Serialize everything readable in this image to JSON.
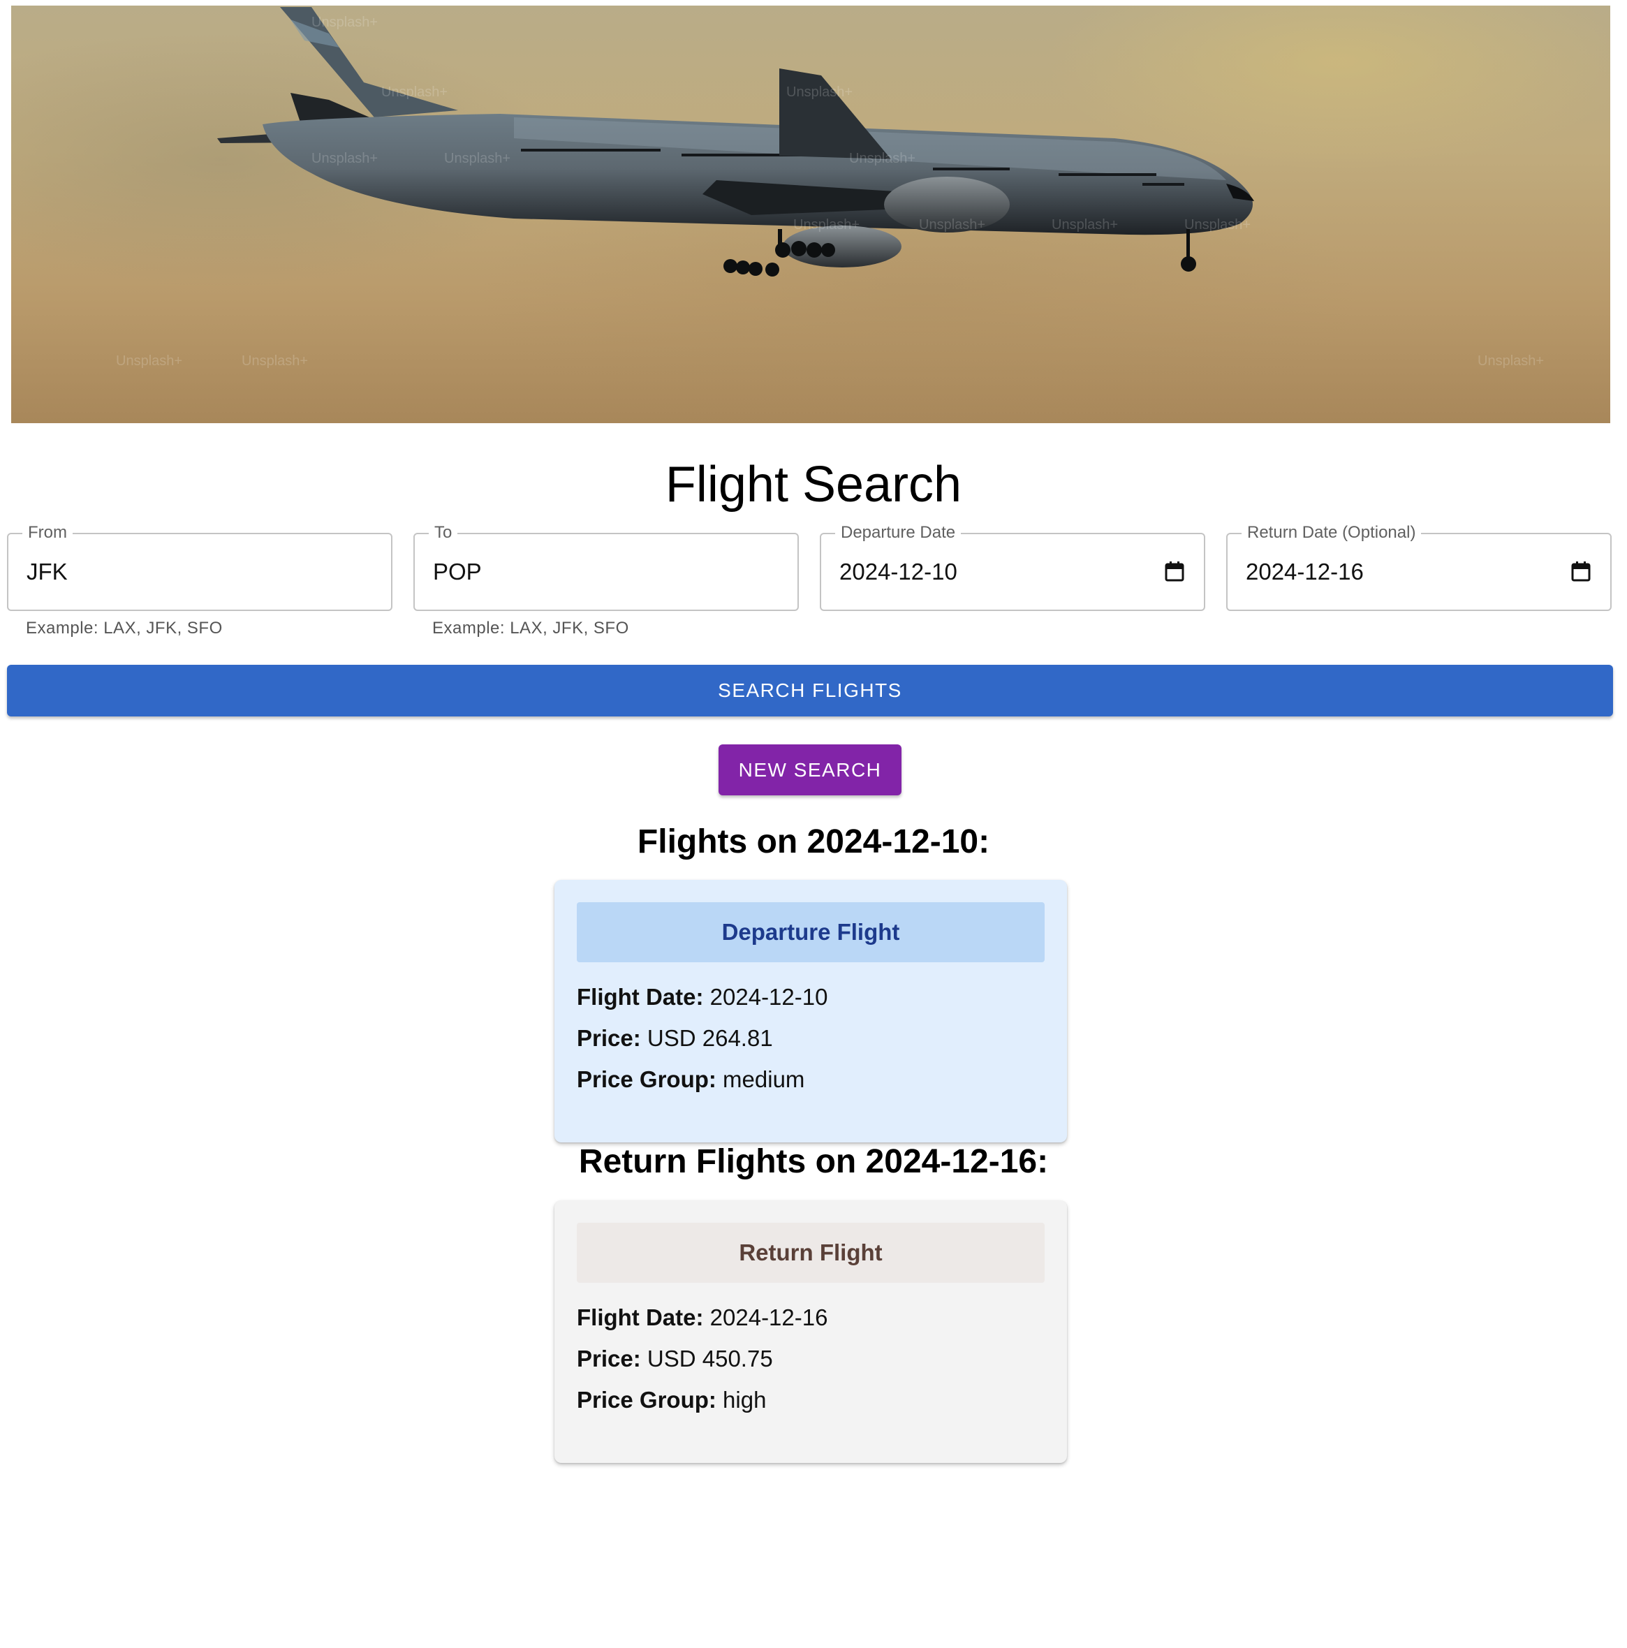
{
  "page": {
    "title": "Flight Search"
  },
  "form": {
    "from": {
      "label": "From",
      "value": "JFK",
      "helper": "Example: LAX, JFK, SFO"
    },
    "to": {
      "label": "To",
      "value": "POP",
      "helper": "Example: LAX, JFK, SFO"
    },
    "departure": {
      "label": "Departure Date",
      "value": "2024-12-10",
      "icon": "calendar-icon"
    },
    "return": {
      "label": "Return Date (Optional)",
      "value": "2024-12-16",
      "icon": "calendar-icon"
    },
    "search_label": "SEARCH FLIGHTS",
    "new_search_label": "NEW SEARCH"
  },
  "results": {
    "departure_heading": "Flights on 2024-12-10:",
    "return_heading": "Return Flights on 2024-12-16:",
    "departure_card": {
      "title": "Departure Flight",
      "flight_date_label": "Flight Date:",
      "flight_date": "2024-12-10",
      "price_label": "Price:",
      "price": "USD 264.81",
      "price_group_label": "Price Group:",
      "price_group": "medium"
    },
    "return_card": {
      "title": "Return Flight",
      "flight_date_label": "Flight Date:",
      "flight_date": "2024-12-16",
      "price_label": "Price:",
      "price": "USD 450.75",
      "price_group_label": "Price Group:",
      "price_group": "high"
    }
  },
  "hero": {
    "watermark": "Unsplash+"
  },
  "colors": {
    "search_button": "#3168c7",
    "new_search_button": "#8224a8",
    "departure_card_bg": "#e1eefd",
    "departure_header_bg": "#bad7f6",
    "departure_header_text": "#1d3a8c",
    "return_card_bg": "#f3f3f3",
    "return_header_bg": "#ede9e7",
    "return_header_text": "#5a4038"
  }
}
